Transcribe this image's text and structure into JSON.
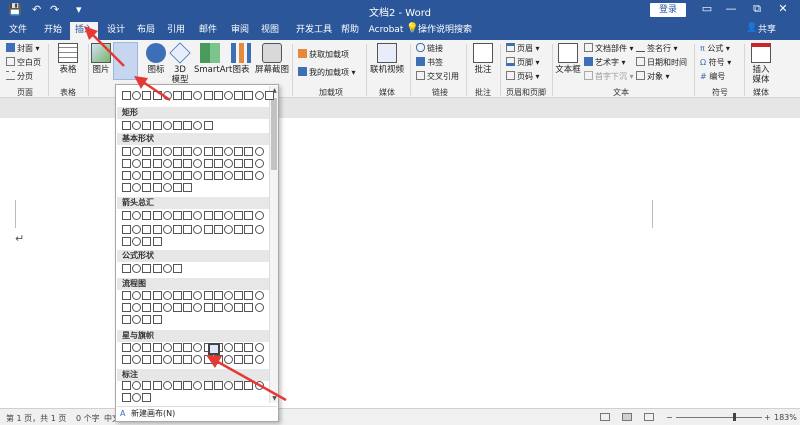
{
  "titlebar": {
    "doc_title": "文档2 - Word",
    "login_label": "登录",
    "qa_save": "💾",
    "qa_undo": "↶",
    "qa_redo": "↷",
    "qa_customize": "▾",
    "ribbon_opts": "▭",
    "minimize": "—",
    "restore": "⧉",
    "close": "✕"
  },
  "tabs": [
    "文件",
    "开始",
    "插入",
    "设计",
    "布局",
    "引用",
    "邮件",
    "审阅",
    "视图",
    "开发工具",
    "帮助",
    "Acrobat"
  ],
  "active_tab": "插入",
  "tell_me": "操作说明搜索",
  "share": "共享",
  "ribbon": {
    "pages": {
      "items": [
        "封面",
        "空白页",
        "分页"
      ],
      "label": "页面"
    },
    "tables": {
      "button": "表格",
      "label": "表格"
    },
    "illus": {
      "picture": "图片",
      "shapes": "形状",
      "icons": "图标",
      "model3d": "3D",
      "model3d_2": "模型",
      "smartart": "SmartArt",
      "chart": "图表",
      "screenshot": "屏幕截图"
    },
    "addins": {
      "get": "获取加载项",
      "my": "我的加载项",
      "label": "加载项"
    },
    "media": {
      "video": "联机视频",
      "label": "媒体"
    },
    "links": {
      "items": [
        "链接",
        "书签",
        "交叉引用"
      ],
      "label": "链接"
    },
    "comments": {
      "button": "批注",
      "label": "批注"
    },
    "header_footer": {
      "items": [
        "页眉",
        "页脚",
        "页码"
      ],
      "label": "页眉和页脚"
    },
    "text": {
      "textbox": "文本框",
      "col1": [
        "文档部件",
        "艺术字",
        "首字下沉"
      ],
      "col2": [
        "签名行",
        "日期和时间",
        "对象"
      ],
      "label": "文本"
    },
    "symbols": {
      "items": [
        "公式",
        "符号",
        "编号"
      ],
      "label": "符号"
    },
    "embed": {
      "button1": "插入",
      "button2": "媒体",
      "label": "媒体"
    }
  },
  "shapes_menu": {
    "categories": [
      "矩形",
      "基本形状",
      "箭头总汇",
      "公式形状",
      "流程图",
      "星与旗帜",
      "标注"
    ],
    "new_canvas": "新建画布(N)"
  },
  "status": {
    "page": "第 1 页，共 1 页",
    "words": "0 个字",
    "lang": "中文",
    "zoom": "183%"
  },
  "colors": {
    "accent": "#2b579a",
    "arrow": "#e53935"
  }
}
